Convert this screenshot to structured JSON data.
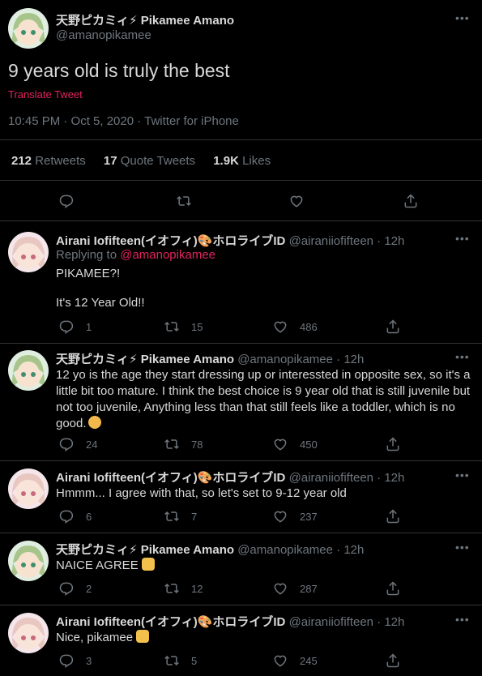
{
  "main_tweet": {
    "name": "天野ピカミィ⚡ Pikamee Amano",
    "handle": "@amanopikamee",
    "text": "9 years old is truly the best",
    "translate": "Translate Tweet",
    "meta": "10:45 PM · Oct 5, 2020 · Twitter for iPhone",
    "retweets_count": "212",
    "retweets_label": "Retweets",
    "quotes_count": "17",
    "quotes_label": "Quote Tweets",
    "likes_count": "1.9K",
    "likes_label": "Likes"
  },
  "replies": [
    {
      "name": "Airani Iofifteen(イオフィ)🎨ホロライブID",
      "handle": "@airaniiofifteen · 12h",
      "replying_prefix": "Replying to ",
      "replying_to": "@amanopikamee",
      "text_line1": "PIKAMEE?!",
      "text_line2": "It's 12 Year Old!!",
      "replies": "1",
      "retweets": "15",
      "likes": "486"
    },
    {
      "name": "天野ピカミィ⚡ Pikamee Amano",
      "handle": "@amanopikamee · 12h",
      "text": "12 yo is the age they start dressing up or interessted in opposite sex, so it's a little bit too mature. I think the best choice is 9 year old that is still juvenile but not too juvenile, Anything less than that still feels like a toddler, which is no good.",
      "replies": "24",
      "retweets": "78",
      "likes": "450"
    },
    {
      "name": "Airani Iofifteen(イオフィ)🎨ホロライブID",
      "handle": "@airaniiofifteen · 12h",
      "text": "Hmmm... I agree with that, so let's set to 9-12 year old",
      "replies": "6",
      "retweets": "7",
      "likes": "237"
    },
    {
      "name": "天野ピカミィ⚡ Pikamee Amano",
      "handle": "@amanopikamee · 12h",
      "text": "NAICE AGREE",
      "replies": "2",
      "retweets": "12",
      "likes": "287"
    },
    {
      "name": "Airani Iofifteen(イオフィ)🎨ホロライブID",
      "handle": "@airaniiofifteen · 12h",
      "text": "Nice, pikamee",
      "replies": "3",
      "retweets": "5",
      "likes": "245"
    }
  ],
  "colors": {
    "background": "#000000",
    "text": "#d9d9d9",
    "secondary": "#6e767d",
    "accent": "#e0245e",
    "divider": "#2f3336"
  },
  "icons": [
    "reply-icon",
    "retweet-icon",
    "like-icon",
    "share-icon",
    "more-icon"
  ]
}
